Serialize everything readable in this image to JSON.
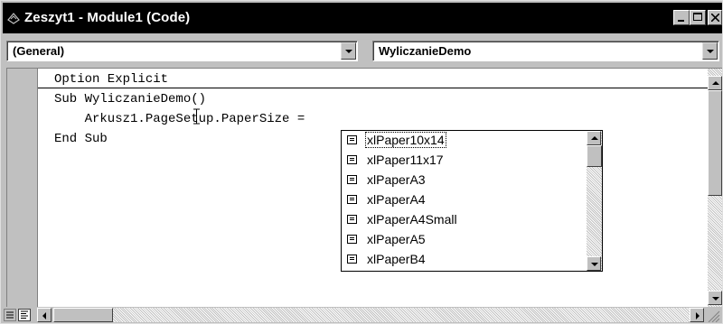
{
  "window": {
    "title": "Zeszyt1 - Module1 (Code)",
    "app_icon": "vba-module-icon",
    "controls": [
      "minimize-icon",
      "maximize-icon",
      "close-icon"
    ]
  },
  "object_combo": {
    "value": "(General)"
  },
  "procedure_combo": {
    "value": "WyliczanieDemo"
  },
  "code": {
    "lines": [
      "Option Explicit",
      "Sub WyliczanieDemo()",
      "    Arkusz1.PageSetup.PaperSize =",
      "End Sub"
    ]
  },
  "autocomplete": {
    "items": [
      "xlPaper10x14",
      "xlPaper11x17",
      "xlPaperA3",
      "xlPaperA4",
      "xlPaperA4Small",
      "xlPaperA5",
      "xlPaperB4"
    ],
    "selected_index": 0,
    "item_icon": "constant-icon"
  },
  "view_buttons": [
    "procedure-view-icon",
    "full-module-view-icon"
  ],
  "colors": {
    "titlebar": "#000000",
    "face": "#c0c0c0",
    "editor": "#ffffff"
  }
}
